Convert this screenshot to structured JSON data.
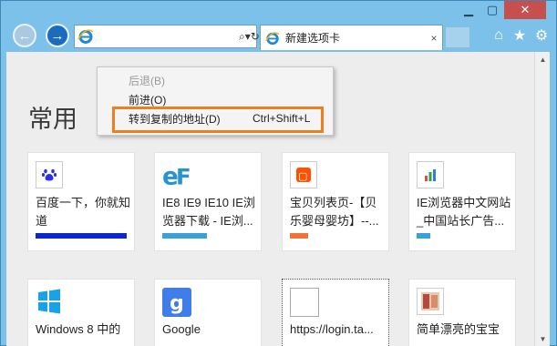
{
  "browser": {
    "address": {
      "value": "",
      "placeholder": ""
    },
    "tab": {
      "title": "新建选项卡",
      "close": "×"
    }
  },
  "page": {
    "heading": "常用",
    "tiles": [
      {
        "title": "百度一下，你就知道",
        "bar_color": "#0d27ce",
        "bar_fraction": 0.96,
        "icon": "baidu-paw-icon"
      },
      {
        "title": "IE8 IE9 IE10 IE浏览器下载 - IE浏...",
        "bar_color": "#3aa0d8",
        "bar_fraction": 0.47,
        "icon": "ie-ef-logo-icon"
      },
      {
        "title": "宝贝列表页-【贝乐婴母婴坊】--...",
        "bar_color": "#f0733a",
        "bar_fraction": 0.19,
        "icon": "taobao-icon"
      },
      {
        "title": "IE浏览器中文网站_中国站长广告...",
        "bar_color": "#3aa0d8",
        "bar_fraction": 0.14,
        "icon": "chart-icon"
      },
      {
        "title": "Windows 8 中的",
        "bar_color": "",
        "bar_fraction": 0,
        "icon": "windows-logo-icon"
      },
      {
        "title": "Google",
        "bar_color": "",
        "bar_fraction": 0,
        "icon": "google-g-icon"
      },
      {
        "title": "https://login.ta...",
        "bar_color": "",
        "bar_fraction": 0,
        "icon": "blank-page-icon"
      },
      {
        "title": "简单漂亮的宝宝",
        "bar_color": "",
        "bar_fraction": 0,
        "icon": "photo-thumb-icon"
      }
    ]
  },
  "context_menu": {
    "back": "后退(B)",
    "forward": "前进(O)",
    "go_to_copied": "转到复制的地址(D)",
    "go_to_copied_shortcut": "Ctrl+Shift+L"
  },
  "colors": {
    "highlight": "#f07e1e",
    "frame": "#7cc1e9"
  }
}
